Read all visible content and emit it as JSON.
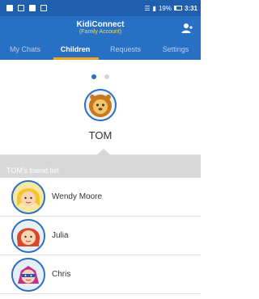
{
  "status_bar": {
    "battery": "19%",
    "time": "3:31"
  },
  "header": {
    "title": "KidiConnect",
    "subtitle": "(Family Account)",
    "add_icon": "add-user-icon"
  },
  "tabs": [
    {
      "label": "My Chats",
      "active": false
    },
    {
      "label": "Children",
      "active": true
    },
    {
      "label": "Requests",
      "active": false
    },
    {
      "label": "Settings",
      "active": false
    }
  ],
  "pager": {
    "pages": 2,
    "current": 1
  },
  "child": {
    "name": "TOM",
    "avatar": "lion-avatar"
  },
  "friends_header": "TOM's friend list",
  "friends": [
    {
      "name": "Wendy Moore",
      "avatar": "yellow-hair-girl-avatar"
    },
    {
      "name": "Julia",
      "avatar": "red-hair-girl-avatar"
    },
    {
      "name": "Chris",
      "avatar": "superhero-avatar"
    }
  ],
  "colors": {
    "primary": "#2770c4",
    "accent": "#f4a423",
    "subtitle": "#ffd84a"
  }
}
